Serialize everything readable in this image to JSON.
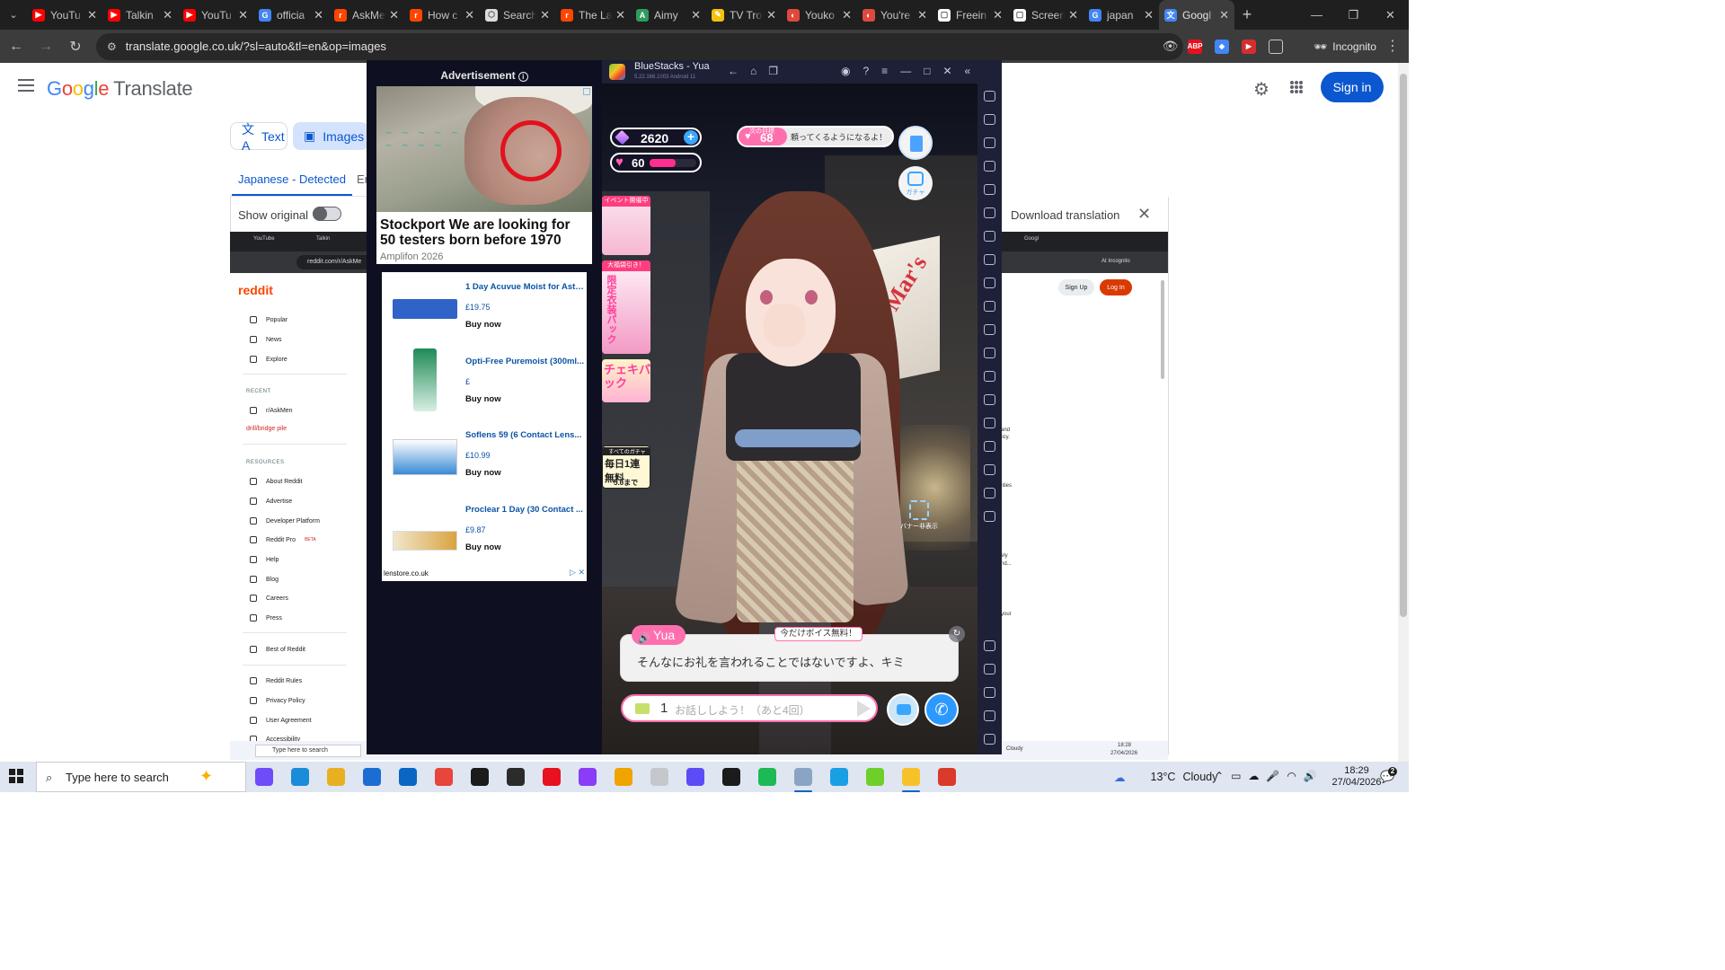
{
  "browser": {
    "tabs": [
      {
        "title": "YouTu",
        "fav": "#ff0000",
        "glyph": "▶"
      },
      {
        "title": "Talkin",
        "fav": "#ff0000",
        "glyph": "▶"
      },
      {
        "title": "YouTu",
        "fav": "#ff0000",
        "glyph": "▶"
      },
      {
        "title": "officia",
        "fav": "#4285f4",
        "glyph": "G"
      },
      {
        "title": "AskMe",
        "fav": "#ff4500",
        "glyph": "r"
      },
      {
        "title": "How c",
        "fav": "#ff4500",
        "glyph": "r"
      },
      {
        "title": "Search",
        "fav": "#dddddd",
        "glyph": "⬡"
      },
      {
        "title": "The La",
        "fav": "#ff4500",
        "glyph": "r"
      },
      {
        "title": "Aimy",
        "fav": "#2e9d5b",
        "glyph": "A"
      },
      {
        "title": "TV Tro",
        "fav": "#f4c20d",
        "glyph": "✎"
      },
      {
        "title": "Youko",
        "fav": "#e0483e",
        "glyph": "◐"
      },
      {
        "title": "You're",
        "fav": "#e0483e",
        "glyph": "◐"
      },
      {
        "title": "Freein",
        "fav": "#ffffff",
        "glyph": "▢"
      },
      {
        "title": "Screen",
        "fav": "#ffffff",
        "glyph": "▢"
      },
      {
        "title": "japan",
        "fav": "#4285f4",
        "glyph": "G"
      },
      {
        "title": "Googl",
        "fav": "#4285f4",
        "glyph": "文",
        "active": true
      }
    ],
    "url": "translate.google.co.uk/?sl=auto&tl=en&op=images",
    "incognito_label": "Incognito",
    "ext_abp": "ABP"
  },
  "translate": {
    "logo_google": [
      "G",
      "o",
      "o",
      "g",
      "l",
      "e"
    ],
    "logo_product": "Translate",
    "signin": "Sign in",
    "mode_text": "Text",
    "mode_images": "Images",
    "source_lang": "Japanese - Detected",
    "target_lang_fragment": "En",
    "show_original": "Show original",
    "download": "Download translation"
  },
  "mini_shot": {
    "url": "reddit.com/r/AskMe",
    "tab1": "YouTube",
    "tab2": "Talkin",
    "tab_right": "Googl",
    "incognito": "At Incognito",
    "logo": "reddit",
    "nav": [
      "Popular",
      "News",
      "Explore"
    ],
    "recent_head": "RECENT",
    "recent_items": [
      "r/AskMen"
    ],
    "recent_red": "drill/bridge pile",
    "resources_head": "RESOURCES",
    "resources": [
      "About Reddit",
      "Advertise",
      "Developer Platform",
      "Reddit Pro",
      "Help",
      "Blog",
      "Careers",
      "Press"
    ],
    "beta": "BETA",
    "best": "Best of Reddit",
    "legal": [
      "Reddit Rules",
      "Privacy Policy",
      "User Agreement",
      "Accessibility"
    ],
    "signup": "Sign Up",
    "login": "Log In",
    "search": "Type here to search",
    "weather": "Cloudy",
    "time": "18:28",
    "date": "27/04/2026",
    "right_frags": [
      "lities",
      "ely",
      "nd...",
      "your",
      "and",
      "licy."
    ]
  },
  "advert": {
    "label": "Advertisement",
    "headline": "Stockport We are looking for 50 testers born before 1970",
    "sponsor": "Amplifon 2026",
    "products": [
      {
        "name": "1 Day Acuvue Moist for Asti...",
        "price": "£19.75",
        "buy": "Buy now",
        "color": "#2f63c7"
      },
      {
        "name": "Opti-Free Puremoist (300ml...",
        "price": "£",
        "buy": "Buy now",
        "color": "#1f8a57"
      },
      {
        "name": "Soflens 59 (6 Contact Lens...",
        "price": "£10.99",
        "buy": "Buy now",
        "color": "#3a8ad6"
      },
      {
        "name": "Proclear 1 Day (30 Contact ...",
        "price": "£9.87",
        "buy": "Buy now",
        "color": "#d9a441"
      }
    ],
    "footer": "lenstore.co.uk"
  },
  "bluestacks": {
    "title": "BlueStacks - Yua",
    "version": "5.22.166.1003 Android 11"
  },
  "game": {
    "gems": "2620",
    "hearts": "60",
    "hearts_fill": 0.55,
    "goal_small": "次の目標",
    "goal_num": "68",
    "goal_msg": "頼ってくるようになるよ！",
    "gacha_label": "ガチャ",
    "banner1_tag": "イベント開催中",
    "banner2_tag": "大福袋引き！",
    "banner2_text": "限定衣装パック",
    "banner3_text": "チェキパック",
    "banner4_text": "毎日1連無料",
    "banner4_date": "5.6まで",
    "banner4_top": "すべてのガチャ",
    "fullscreen_label": "バナー非表示",
    "speaker": "Yua",
    "voice_tag": "今だけボイス無料！",
    "dialog": "そんなにお礼を言われることではないですよ、キミ",
    "chat_count": "1",
    "chat_placeholder": "お話ししよう！（あと4回）"
  },
  "taskbar": {
    "search": "Type here to search",
    "temp": "13°C",
    "weather": "Cloudy",
    "time": "18:29",
    "date": "27/04/2026",
    "notifications": "2",
    "apps": [
      "#6f4cf7",
      "#1a8cd8",
      "#e8b020",
      "#1b6dd1",
      "#0a66c2",
      "#e8453c",
      "#1b1b1b",
      "#2b2b2b",
      "#e8111e",
      "#8a3cf7",
      "#f0a400",
      "#c5c7cc",
      "#5b4cf7",
      "#1b1b1b",
      "#1db954",
      "#8aa4c4",
      "#19a0e4",
      "#6fcf2a",
      "#f7c12a",
      "#d93a2a"
    ]
  }
}
